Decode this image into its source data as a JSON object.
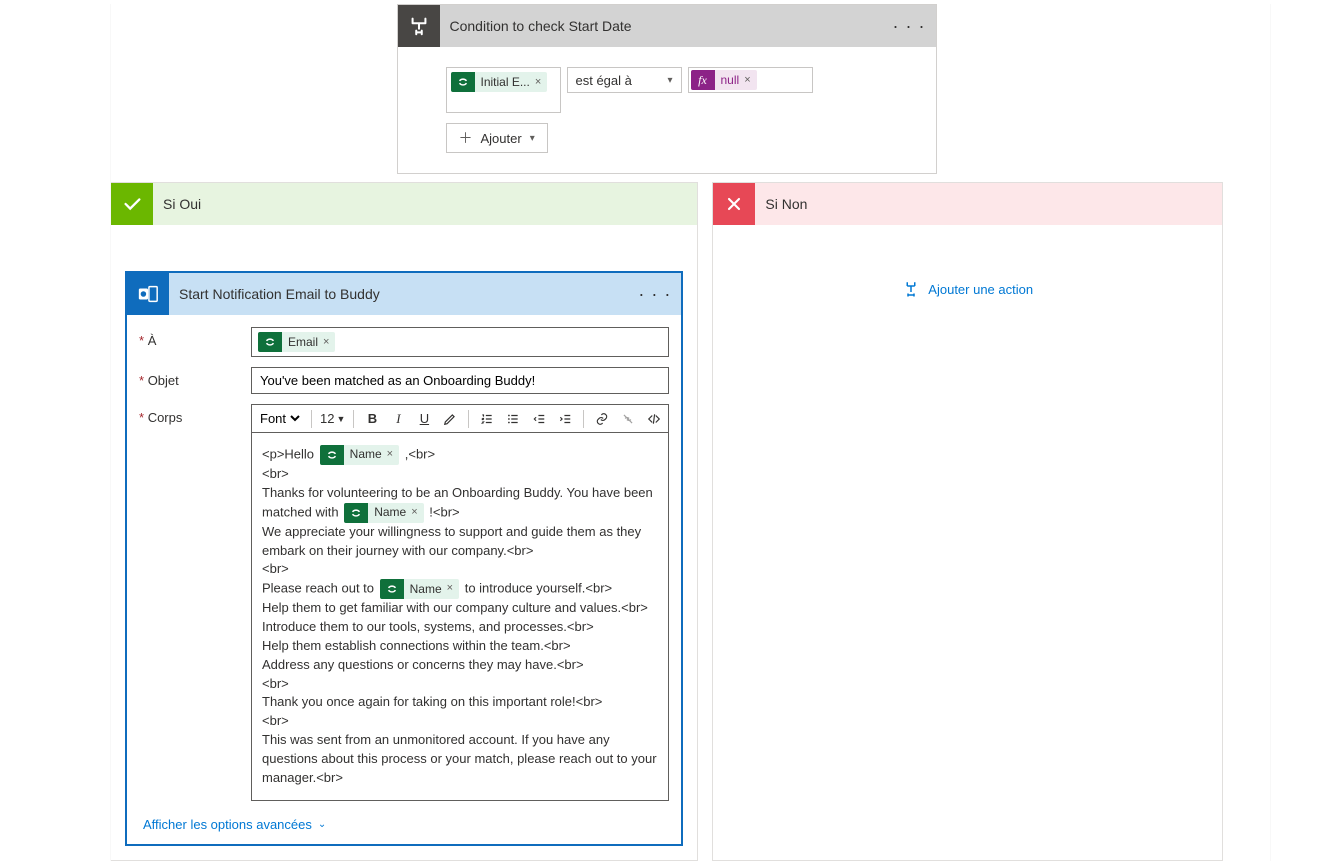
{
  "condition": {
    "title": "Condition to check Start Date",
    "left_token": "Initial E...",
    "operator": "est égal à",
    "right_expr": "null",
    "add_label": "Ajouter"
  },
  "branches": {
    "yes_label": "Si Oui",
    "no_label": "Si Non",
    "add_action_label": "Ajouter une action"
  },
  "action": {
    "title": "Start Notification Email to Buddy",
    "labels": {
      "to": "À",
      "subject": "Objet",
      "body": "Corps"
    },
    "to_token": "Email",
    "subject": "You've been matched as an Onboarding Buddy!",
    "toolbar": {
      "font": "Font",
      "size": "12"
    },
    "body_tokens": {
      "name": "Name"
    },
    "body": {
      "l1a": "<p>Hello ",
      "l1b": ",<br>",
      "l2": "<br>",
      "l3": "Thanks for volunteering to be an Onboarding Buddy. You have been matched with ",
      "l3b": "!<br>",
      "l4": "We appreciate your willingness to support and guide them as they embark on their journey with our company.<br>",
      "l5": "<br>",
      "l6": "Please reach out to ",
      "l6b": " to introduce yourself.<br>",
      "l7": "Help them to get familiar with our company culture and values.<br>",
      "l8": "Introduce them to our tools, systems, and processes.<br>",
      "l9": "Help them establish connections within the team.<br>",
      "l10": "Address any questions or concerns they may have.<br>",
      "l11": "<br>",
      "l12": "Thank you once again for taking on this important role!<br>",
      "l13": "<br>",
      "l14": "This was sent from an unmonitored account. If you have any questions about this process or your match, please reach out to your manager.<br>"
    },
    "show_advanced": "Afficher les options avancées"
  }
}
